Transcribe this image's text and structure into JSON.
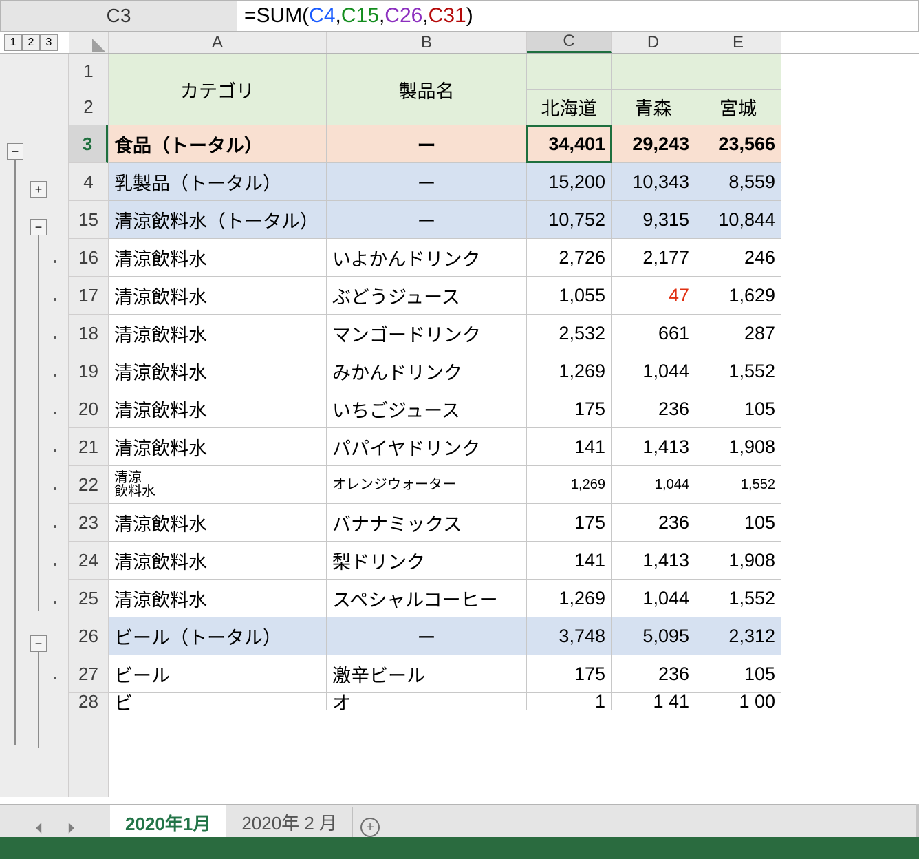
{
  "name_box": "C3",
  "formula": {
    "prefix": "=SUM(",
    "args": [
      "C4",
      "C15",
      "C26",
      "C31"
    ],
    "suffix": ")"
  },
  "outline_levels": [
    "1",
    "2",
    "3"
  ],
  "columns": [
    "A",
    "B",
    "C",
    "D",
    "E"
  ],
  "selected_column": "C",
  "header": {
    "category": "カテゴリ",
    "product": "製品名",
    "regions": [
      "北海道",
      "青森",
      "宮城"
    ]
  },
  "rows": [
    {
      "n": 3,
      "type": "total-food",
      "a": "食品（トータル）",
      "b": "ー",
      "c": "34,401",
      "d": "29,243",
      "e": "23,566"
    },
    {
      "n": 4,
      "type": "total-sub",
      "a": "乳製品（トータル）",
      "b": "ー",
      "c": "15,200",
      "d": "10,343",
      "e": "8,559"
    },
    {
      "n": 15,
      "type": "total-sub",
      "a": "清涼飲料水（トータル）",
      "b": "ー",
      "c": "10,752",
      "d": "9,315",
      "e": "10,844"
    },
    {
      "n": 16,
      "type": "data",
      "a": "清涼飲料水",
      "b": "いよかんドリンク",
      "c": "2,726",
      "d": "2,177",
      "e": "246"
    },
    {
      "n": 17,
      "type": "data",
      "a": "清涼飲料水",
      "b": "ぶどうジュース",
      "c": "1,055",
      "d": "47",
      "e": "1,629",
      "d_red": true
    },
    {
      "n": 18,
      "type": "data",
      "a": "清涼飲料水",
      "b": "マンゴードリンク",
      "c": "2,532",
      "d": "661",
      "e": "287"
    },
    {
      "n": 19,
      "type": "data",
      "a": "清涼飲料水",
      "b": "みかんドリンク",
      "c": "1,269",
      "d": "1,044",
      "e": "1,552"
    },
    {
      "n": 20,
      "type": "data",
      "a": "清涼飲料水",
      "b": "いちごジュース",
      "c": "175",
      "d": "236",
      "e": "105"
    },
    {
      "n": 21,
      "type": "data",
      "a": "清涼飲料水",
      "b": "パパイヤドリンク",
      "c": "141",
      "d": "1,413",
      "e": "1,908"
    },
    {
      "n": 22,
      "type": "data2",
      "a": "清涼\n飲料水",
      "b": "オレンジウォーター",
      "c": "1,269",
      "d": "1,044",
      "e": "1,552"
    },
    {
      "n": 23,
      "type": "data",
      "a": "清涼飲料水",
      "b": "バナナミックス",
      "c": "175",
      "d": "236",
      "e": "105"
    },
    {
      "n": 24,
      "type": "data",
      "a": "清涼飲料水",
      "b": "梨ドリンク",
      "c": "141",
      "d": "1,413",
      "e": "1,908"
    },
    {
      "n": 25,
      "type": "data",
      "a": "清涼飲料水",
      "b": "スペシャルコーヒー",
      "c": "1,269",
      "d": "1,044",
      "e": "1,552"
    },
    {
      "n": 26,
      "type": "total-sub",
      "a": "ビール（トータル）",
      "b": "ー",
      "c": "3,748",
      "d": "5,095",
      "e": "2,312"
    },
    {
      "n": 27,
      "type": "data",
      "a": "ビール",
      "b": "激辛ビール",
      "c": "175",
      "d": "236",
      "e": "105"
    },
    {
      "n": 28,
      "type": "partial",
      "a": "ビ",
      "b": "オ",
      "c": "1",
      "d": "1 41",
      "e": "1 00"
    }
  ],
  "row_heights": {
    "header1": 52,
    "header2": 52,
    "normal": 55,
    "partial": 25
  },
  "tabs": {
    "active": "2020年1月",
    "others": [
      "2020年 2 月"
    ]
  },
  "colors": {
    "accent": "#1e6f3e",
    "status": "#2a6b3f",
    "red": "#e03012"
  }
}
